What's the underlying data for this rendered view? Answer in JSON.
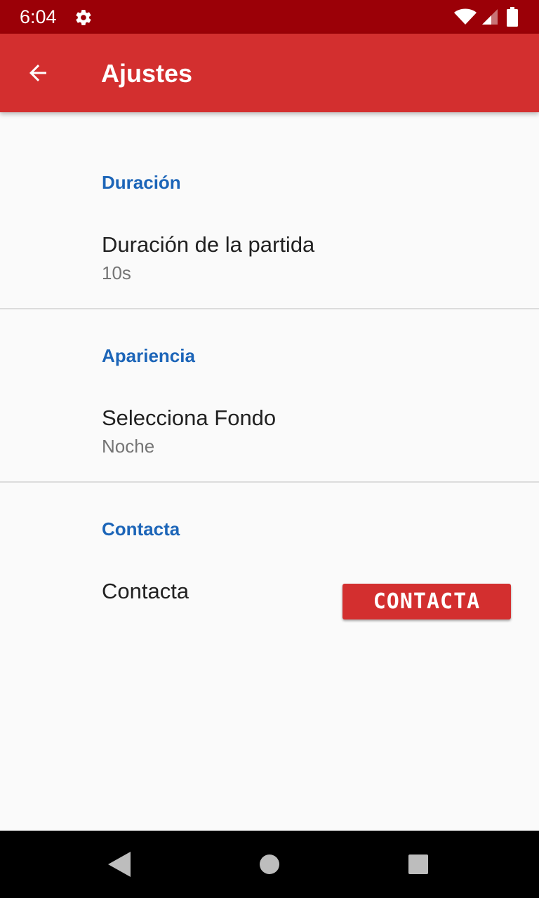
{
  "status_bar": {
    "time": "6:04",
    "icons": [
      "gear-icon",
      "wifi-icon",
      "cell-signal-icon",
      "battery-icon"
    ]
  },
  "app_bar": {
    "title": "Ajustes",
    "back_icon": "arrow-back-icon",
    "color": "#d32f2f"
  },
  "sections": [
    {
      "header": "Duración",
      "pref_title": "Duración de la partida",
      "pref_summary": "10s"
    },
    {
      "header": "Apariencia",
      "pref_title": "Selecciona Fondo",
      "pref_summary": "Noche"
    },
    {
      "header": "Contacta",
      "pref_title": "Contacta",
      "button_label": "CONTACTA"
    }
  ],
  "colors": {
    "accent": "#1c65b8",
    "primary": "#d32f2f",
    "primary_dark": "#9b0007"
  },
  "nav_bar": {
    "icons": [
      "nav-back-icon",
      "nav-home-icon",
      "nav-recents-icon"
    ]
  }
}
